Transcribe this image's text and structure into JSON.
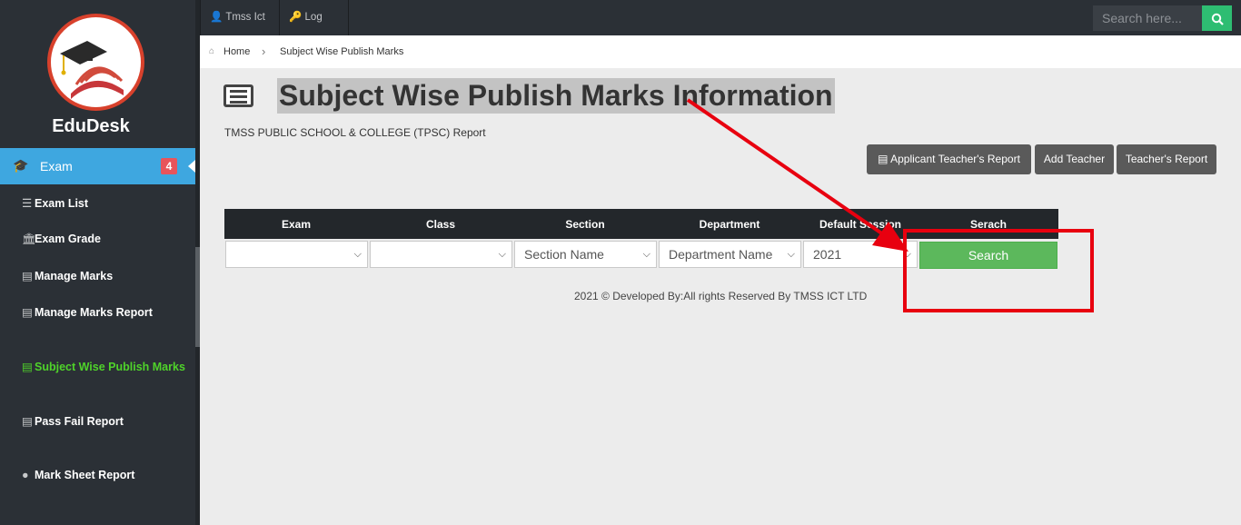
{
  "app": {
    "brand": "EduDesk"
  },
  "topbar": {
    "user_label": "Tmss Ict",
    "logout_label": "Log Out",
    "search_placeholder": "Search here..."
  },
  "sidebar": {
    "active": {
      "label": "Exam",
      "badge": "4"
    },
    "items": [
      {
        "label": "Exam List"
      },
      {
        "label": "Exam Grade"
      },
      {
        "label": "Manage Marks"
      },
      {
        "label": "Manage Marks Report"
      },
      {
        "label": "Subject Wise Publish Marks"
      },
      {
        "label": "Pass Fail Report"
      },
      {
        "label": "Mark Sheet Report"
      }
    ]
  },
  "breadcrumb": {
    "home": "Home",
    "current": "Subject Wise Publish Marks"
  },
  "page": {
    "title": "Subject Wise Publish Marks Information",
    "subtitle": "TMSS PUBLIC SCHOOL & COLLEGE (TPSC) Report",
    "buttons": {
      "applicant_report": "Applicant Teacher's Report",
      "add_teacher": "Add Teacher",
      "teacher_report": "Teacher's Report"
    }
  },
  "filters": {
    "headers": [
      "Exam",
      "Class",
      "Section",
      "Department",
      "Default Session",
      "Serach"
    ],
    "values": {
      "exam": "",
      "class": "",
      "section": "Section Name",
      "department": "Department Name",
      "session": "2021"
    },
    "search_label": "Search"
  },
  "footer": {
    "text": "2021 © Developed By:All rights Reserved By TMSS ICT LTD"
  },
  "colors": {
    "accent": "#3ea7e0",
    "active_link": "#4fd32a",
    "search_green": "#5cb85c",
    "annotation_red": "#e8000f"
  }
}
